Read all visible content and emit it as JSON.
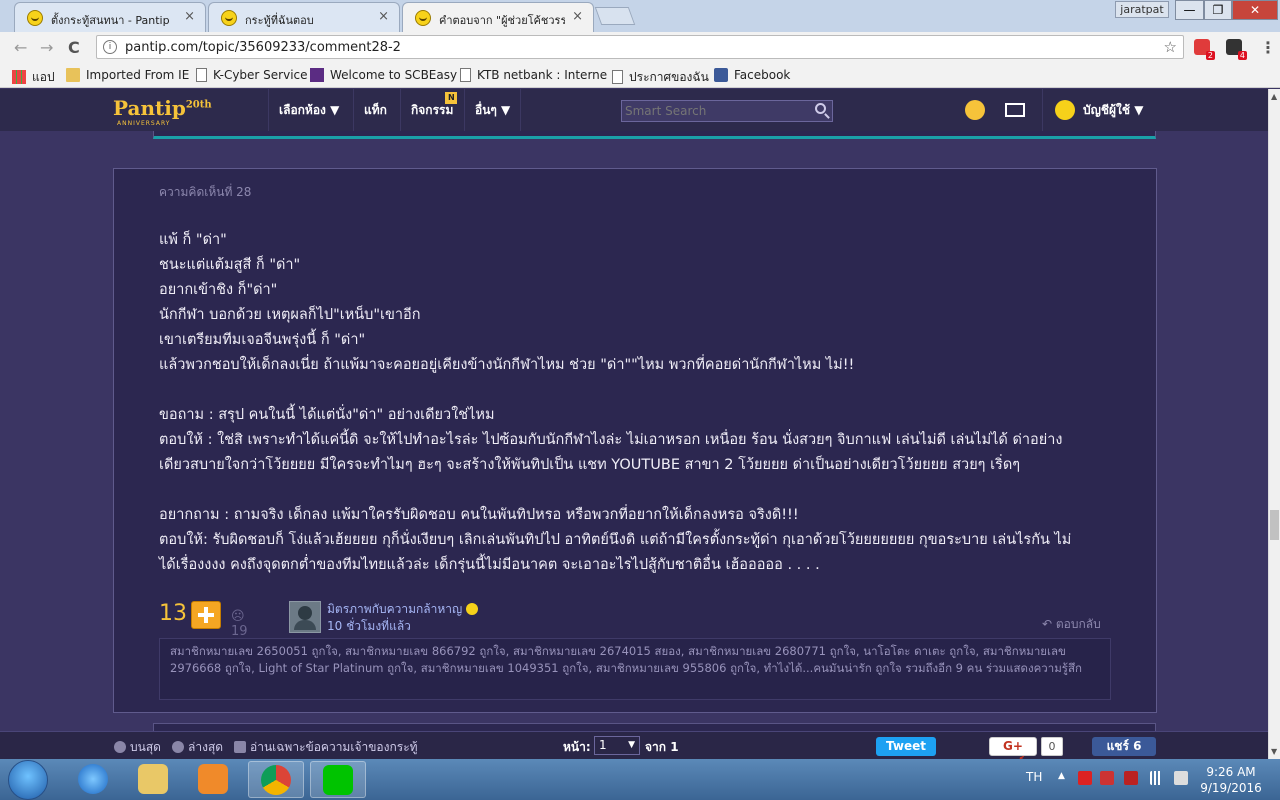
{
  "browser": {
    "tabs": [
      {
        "title": "ตั้งกระทู้สนทนา - Pantip"
      },
      {
        "title": "กระทู้ที่ฉันตอบ"
      },
      {
        "title": "คำตอบจาก \"ผู้ช่วยโค้ชวรรณา\""
      }
    ],
    "close_glyph": "×",
    "user_chip": "jaratpat",
    "window": {
      "min": "—",
      "max": "❐",
      "close": "✕"
    },
    "nav": {
      "back": "←",
      "forward": "→",
      "reload": "C"
    },
    "url": "pantip.com/topic/35609233/comment28-2",
    "info_glyph": "i",
    "star_glyph": "☆",
    "menu_glyph": "⋮",
    "ext_badges": [
      "2",
      "4"
    ],
    "bookmarks": [
      "แอป",
      "Imported From IE",
      "K-Cyber Service",
      "Welcome to SCBEasy",
      "KTB netbank : Interne",
      "ประกาศของฉัน",
      "Facebook"
    ]
  },
  "pantip": {
    "logo": "Pantip",
    "logo_sup": "20th",
    "logo_sub": "ANNIVERSARY",
    "nav": [
      "เลือกห้อง ▼",
      "แท็ก",
      "กิจกรรม",
      "อื่นๆ ▼"
    ],
    "activity_badge": "N",
    "search_placeholder": "Smart Search",
    "account": "บัญชีผู้ใช้ ▼"
  },
  "comment": {
    "number_label": "ความคิดเห็นที่ 28",
    "lines": [
      "แพ้ ก็ \"ด่า\"",
      "ชนะแต่แต้มสูสี ก็ \"ด่า\"",
      "อยากเข้าชิง ก็\"ด่า\"",
      "นักกีฬา บอกด้วย เหตุผลก็ไป\"เหน็บ\"เขาอีก",
      "เขาเตรียมทีมเจอจีนพรุ่งนี้ ก็ \"ด่า\"",
      "แล้วพวกชอบให้เด็กลงเนี่ย ถ้าแพ้มาจะคอยอยู่เคียงข้างนักกีฬาไหม ช่วย \"ด่า\"\"ไหม พวกที่คอยด่านักกีฬาไหม  ไม่!!",
      "ขอถาม : สรุป คนในนี้ ได้แต่นั่ง\"ด่า\" อย่างเดียวใช่ไหม",
      "ตอบให้ : ใช่สิ เพราะทำได้แค่นี้ดิ จะให้ไปทำอะไรล่ะ ไปซ้อมกับนักกีฬาไงล่ะ ไม่เอาหรอก เหนื่อย ร้อน นั่งสวยๆ จิบกาแฟ เล่นไม่ดี เล่นไม่ได้ ด่าอย่าง",
      "เดียวสบายใจกว่าโว้ยยยย มีใครจะทำไมๆ ฮะๆ จะสร้างให้พันทิปเป็น แชท YOUTUBE สาขา 2 โว้ยยยย ด่าเป็นอย่างเดียวโว้ยยยย สวยๆ เริ่ดๆ",
      "อยากถาม : ถามจริง เด็กลง แพ้มาใครรับผิดชอบ คนในพันทิปหรอ หรือพวกที่อยากให้เด็กลงหรอ จริงดิ!!!",
      "ตอบให้: รับผิดชอบก็ โง่แล้วเฮ้ยยยย  กุก็นั่งเงียบๆ เลิกเล่นพันทิปไป อาทิตย์นึงดิ  แต่ถ้ามีใครตั้งกระทู้ด่า กุเอาด้วยโว้ยยยยยยย กุขอระบาย เล่นไรกัน ไม่",
      "ได้เรื่องงงง คงถึงจุดตกต่ำของทีมไทยแล้วล่ะ เด็กรุ่นนี้ไม่มีอนาคต จะเอาอะไรไปสู้กับชาติอื่น เฮ้อออออ . . . ."
    ],
    "votes": "13",
    "emotions": "19",
    "author": "มิตรภาพกับความกล้าหาญ",
    "time": "10 ชั่วโมงที่แล้ว",
    "reply": "ตอบกลับ",
    "likers_text": "สมาชิกหมายเลข 2650051 ถูกใจ, สมาชิกหมายเลข 866792 ถูกใจ, สมาชิกหมายเลข 2674015 สยอง, สมาชิกหมายเลข 2680771 ถูกใจ, นาโอโตะ ดาเตะ ถูกใจ, สมาชิกหมายเลข 2976668 ถูกใจ, Light of Star Platinum ถูกใจ, สมาชิกหมายเลข 1049351 ถูกใจ, สมาชิกหมายเลข 955806 ถูกใจ, ทำไงได้...คนมันน่ารัก ถูกใจ รวมถึงอีก 9 คน ร่วมแสดงความรู้สึก"
  },
  "footer": {
    "top": "บนสุด",
    "bottom": "ล่างสุด",
    "owner_only": "อ่านเฉพาะข้อความเจ้าของกระทู้",
    "page_label": "หน้า:",
    "page_value": "1",
    "page_of": "จาก 1",
    "tweet": "Tweet",
    "gplus": "G+ แชร์",
    "gplus_count": "0",
    "fb_share": "แชร์ 6"
  },
  "taskbar": {
    "lang": "TH",
    "time": "9:26 AM",
    "date": "9/19/2016"
  },
  "colors": {
    "page_bg": "#3b3563",
    "card_bg": "#2c2750",
    "accent_yellow": "#f6c33a",
    "link_blue": "#a6b6f5"
  }
}
